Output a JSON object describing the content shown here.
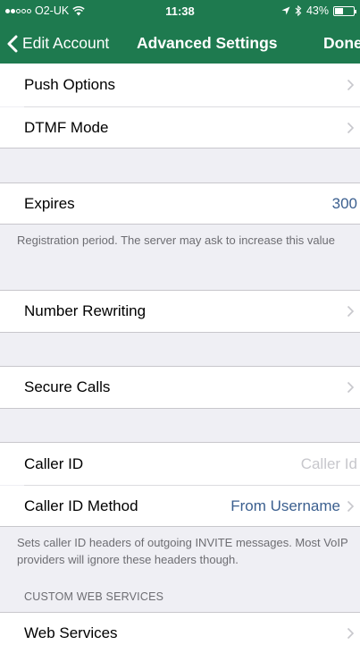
{
  "status_bar": {
    "carrier": "O2-UK",
    "time": "11:38",
    "battery": "43%",
    "battery_level": 0.43,
    "signal_bars_filled": 2,
    "signal_bars_total": 5
  },
  "nav": {
    "back_label": "Edit Account",
    "title": "Advanced Settings",
    "done_label": "Done"
  },
  "rows": {
    "push_options": {
      "label": "Push Options"
    },
    "dtmf_mode": {
      "label": "DTMF Mode"
    },
    "expires": {
      "label": "Expires",
      "value": "300"
    },
    "number_rewriting": {
      "label": "Number Rewriting"
    },
    "secure_calls": {
      "label": "Secure Calls"
    },
    "caller_id": {
      "label": "Caller ID",
      "placeholder": "Caller Id"
    },
    "caller_id_method": {
      "label": "Caller ID Method",
      "value": "From Username"
    },
    "web_services": {
      "label": "Web Services"
    }
  },
  "footers": {
    "expires": "Registration period. The server may ask to increase this value",
    "caller_id": "Sets caller ID headers of outgoing INVITE messages. Most VoIP providers will ignore these headers though."
  },
  "section_headers": {
    "custom_web_services": "CUSTOM WEB SERVICES"
  },
  "colors": {
    "header_bg": "#1e7a4f",
    "value_text": "#3b5f8f",
    "background": "#efeff4"
  }
}
